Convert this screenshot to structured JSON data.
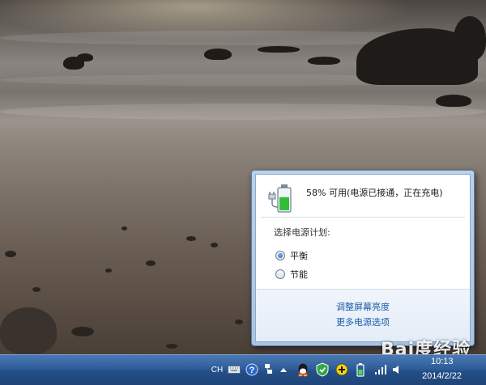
{
  "battery_flyout": {
    "status_text": "58% 可用(电源已接通，正在充电)",
    "charge_fraction": 0.58,
    "plan_heading": "选择电源计划:",
    "plans": [
      {
        "label": "平衡",
        "selected": true
      },
      {
        "label": "节能",
        "selected": false
      }
    ],
    "links": [
      "调整屏幕亮度",
      "更多电源选项"
    ]
  },
  "taskbar": {
    "language": "CH",
    "clock_time": "10:13",
    "clock_date": "2014/2/22",
    "tray_icons": [
      "keyboard-icon",
      "help-icon",
      "network-icon",
      "show-hidden-icons-icon",
      "qq-icon",
      "security-shield-icon",
      "add-icon",
      "battery-plug-icon",
      "signal-icon",
      "volume-icon"
    ]
  },
  "watermark": "Bai度经验",
  "colors": {
    "link": "#1e5aa8",
    "taskbar": "#2f5d99",
    "battery_fill": "#2fbf3a"
  }
}
